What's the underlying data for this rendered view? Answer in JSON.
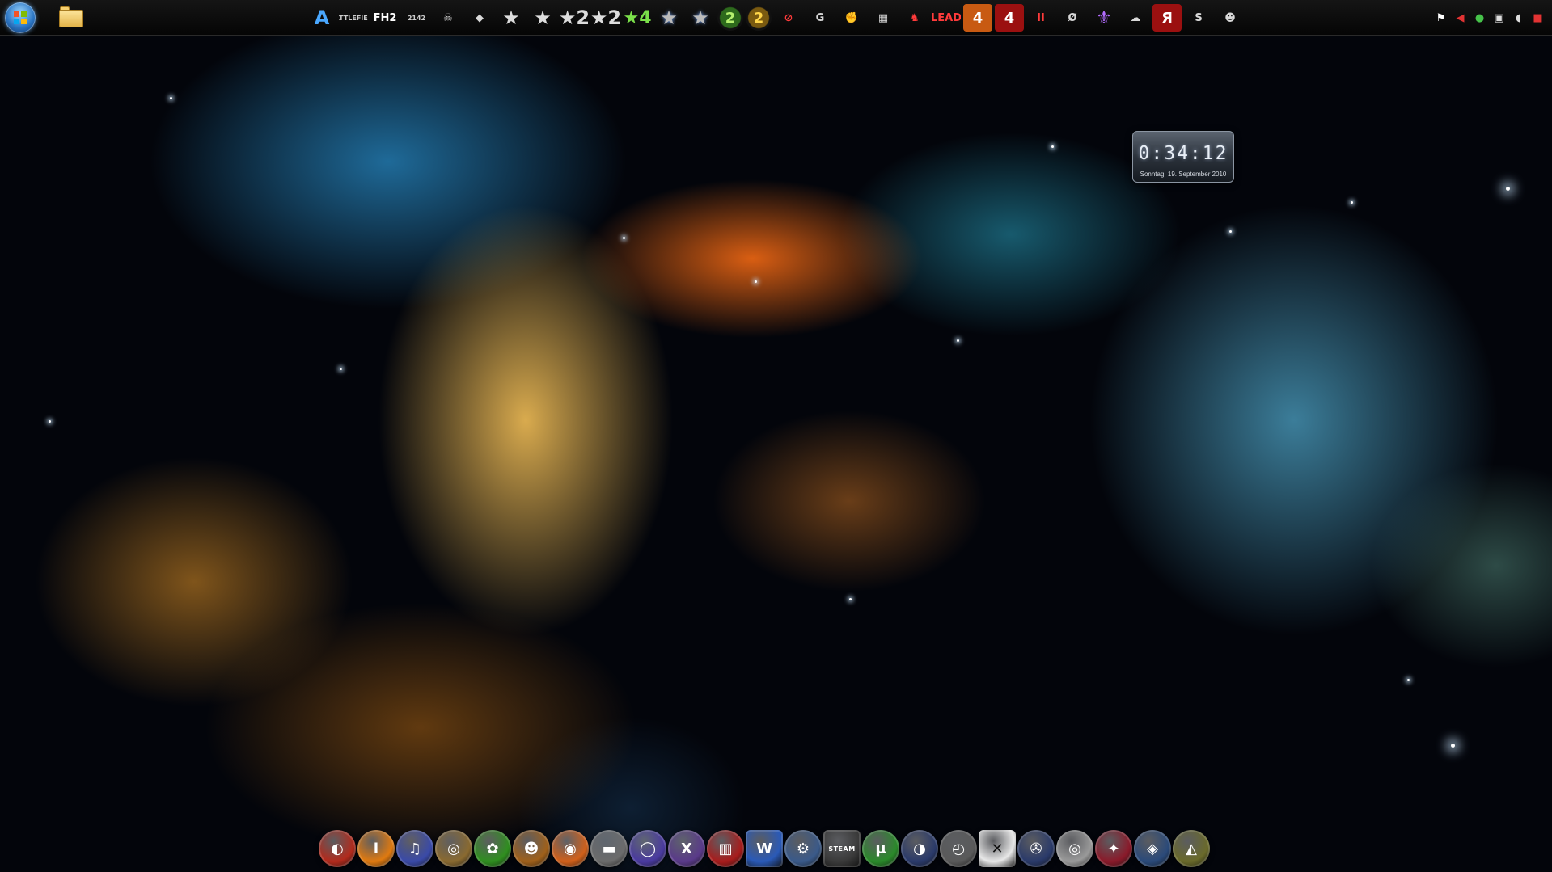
{
  "taskbar": {
    "start_button": "start",
    "explorer_button": "folder",
    "game_icons": [
      {
        "name": "icon-01",
        "glyph": "A",
        "style": "g-blue"
      },
      {
        "name": "icon-02",
        "glyph": "BATTLEFIELD",
        "style": "g-small"
      },
      {
        "name": "icon-03",
        "glyph": "FH2",
        "style": ""
      },
      {
        "name": "icon-04",
        "glyph": "2142",
        "style": "g-small"
      },
      {
        "name": "icon-05",
        "glyph": "☠",
        "style": "g-gray"
      },
      {
        "name": "icon-06",
        "glyph": "◆",
        "style": "g-gray"
      },
      {
        "name": "icon-07",
        "glyph": "★",
        "style": "g-star"
      },
      {
        "name": "icon-08",
        "glyph": "★",
        "style": "g-star"
      },
      {
        "name": "icon-09",
        "glyph": "★2",
        "style": "g-star"
      },
      {
        "name": "icon-10",
        "glyph": "★2",
        "style": "g-star"
      },
      {
        "name": "icon-11",
        "glyph": "★4",
        "style": "g-green"
      },
      {
        "name": "icon-12",
        "glyph": "★",
        "style": "g-star2"
      },
      {
        "name": "icon-13",
        "glyph": "★",
        "style": "g-star2"
      },
      {
        "name": "icon-14",
        "glyph": "2",
        "style": "g-two"
      },
      {
        "name": "icon-15",
        "glyph": "2",
        "style": "g-two-y"
      },
      {
        "name": "icon-16",
        "glyph": "⊘",
        "style": "g-red"
      },
      {
        "name": "icon-17",
        "glyph": "G",
        "style": "g-gray"
      },
      {
        "name": "icon-18",
        "glyph": "✊",
        "style": "g-gray"
      },
      {
        "name": "icon-19",
        "glyph": "▦",
        "style": "g-gray"
      },
      {
        "name": "icon-20",
        "glyph": "♞",
        "style": "g-red"
      },
      {
        "name": "icon-21",
        "glyph": "LEAD",
        "style": "g-red"
      },
      {
        "name": "icon-22",
        "glyph": "4",
        "style": "g-orange"
      },
      {
        "name": "icon-23",
        "glyph": "4",
        "style": "g-redbox"
      },
      {
        "name": "icon-24",
        "glyph": "II",
        "style": "g-red"
      },
      {
        "name": "icon-25",
        "glyph": "Ø",
        "style": "g-gray"
      },
      {
        "name": "icon-26",
        "glyph": "⚜",
        "style": "g-purple"
      },
      {
        "name": "icon-27",
        "glyph": "☁",
        "style": "g-gray"
      },
      {
        "name": "icon-28",
        "glyph": "Я",
        "style": "g-redbox"
      },
      {
        "name": "icon-29",
        "glyph": "S",
        "style": "g-gray"
      },
      {
        "name": "icon-30",
        "glyph": "☻",
        "style": "g-gray"
      }
    ],
    "tray": [
      {
        "name": "action-center-flag-icon",
        "glyph": "⚑"
      },
      {
        "name": "red-arrow-icon",
        "glyph": "◀"
      },
      {
        "name": "green-shield-icon",
        "glyph": "●"
      },
      {
        "name": "network-icon",
        "glyph": "▣"
      },
      {
        "name": "volume-icon",
        "glyph": "◖"
      },
      {
        "name": "app-tray-icon",
        "glyph": "■"
      }
    ]
  },
  "clock": {
    "time": "0:34:12",
    "date": "Sonntag, 19. September 2010"
  },
  "dock": {
    "icons": [
      {
        "name": "dock-icon-01",
        "glyph": "◐",
        "bg": "#b22a1c"
      },
      {
        "name": "dock-icon-02",
        "glyph": "i",
        "bg": "#e07a10"
      },
      {
        "name": "dock-icon-03",
        "glyph": "♫",
        "bg": "#3a4aa8"
      },
      {
        "name": "dock-icon-04",
        "glyph": "◎",
        "bg": "#8a6a30"
      },
      {
        "name": "dock-icon-05",
        "glyph": "✿",
        "bg": "#2f8f1f"
      },
      {
        "name": "dock-icon-06",
        "glyph": "☻",
        "bg": "#a0601a"
      },
      {
        "name": "dock-icon-07",
        "glyph": "◉",
        "bg": "#d2601a"
      },
      {
        "name": "dock-icon-08",
        "glyph": "▬",
        "bg": "#6c6c6c"
      },
      {
        "name": "dock-icon-09",
        "glyph": "◯",
        "bg": "#4a3aa0"
      },
      {
        "name": "dock-icon-10",
        "glyph": "X",
        "bg": "#5a3a8a"
      },
      {
        "name": "dock-icon-11",
        "glyph": "▥",
        "bg": "#a81c1c"
      },
      {
        "name": "dock-icon-12",
        "glyph": "W",
        "bg": "#2a5ab8",
        "shape": "square"
      },
      {
        "name": "dock-icon-13",
        "glyph": "⚙",
        "bg": "#3a5a8a"
      },
      {
        "name": "dock-icon-14",
        "glyph": "STEAM",
        "bg": "#3a3a3a",
        "shape": "square",
        "style": "steam"
      },
      {
        "name": "dock-icon-15",
        "glyph": "μ",
        "bg": "#2a8a2a"
      },
      {
        "name": "dock-icon-16",
        "glyph": "◑",
        "bg": "#2a3a6a"
      },
      {
        "name": "dock-icon-17",
        "glyph": "◴",
        "bg": "#5a5a5a"
      },
      {
        "name": "dock-icon-18",
        "glyph": "✕",
        "bg": "#e8e8e8",
        "shape": "square"
      },
      {
        "name": "dock-icon-19",
        "glyph": "✇",
        "bg": "#2a3a6a"
      },
      {
        "name": "dock-icon-20",
        "glyph": "◎",
        "bg": "#9a9a9a"
      },
      {
        "name": "dock-icon-21",
        "glyph": "✦",
        "bg": "#8a1a2a"
      },
      {
        "name": "dock-icon-22",
        "glyph": "◈",
        "bg": "#2a4a7a"
      },
      {
        "name": "dock-icon-23",
        "glyph": "◭",
        "bg": "#6a6a2a"
      }
    ]
  },
  "colors": {
    "taskbar_bg": "#0a0a0a",
    "space_bg": "#03050b",
    "nebula_orange": "#ff7a1a",
    "nebula_blue": "#3a9ad8"
  }
}
